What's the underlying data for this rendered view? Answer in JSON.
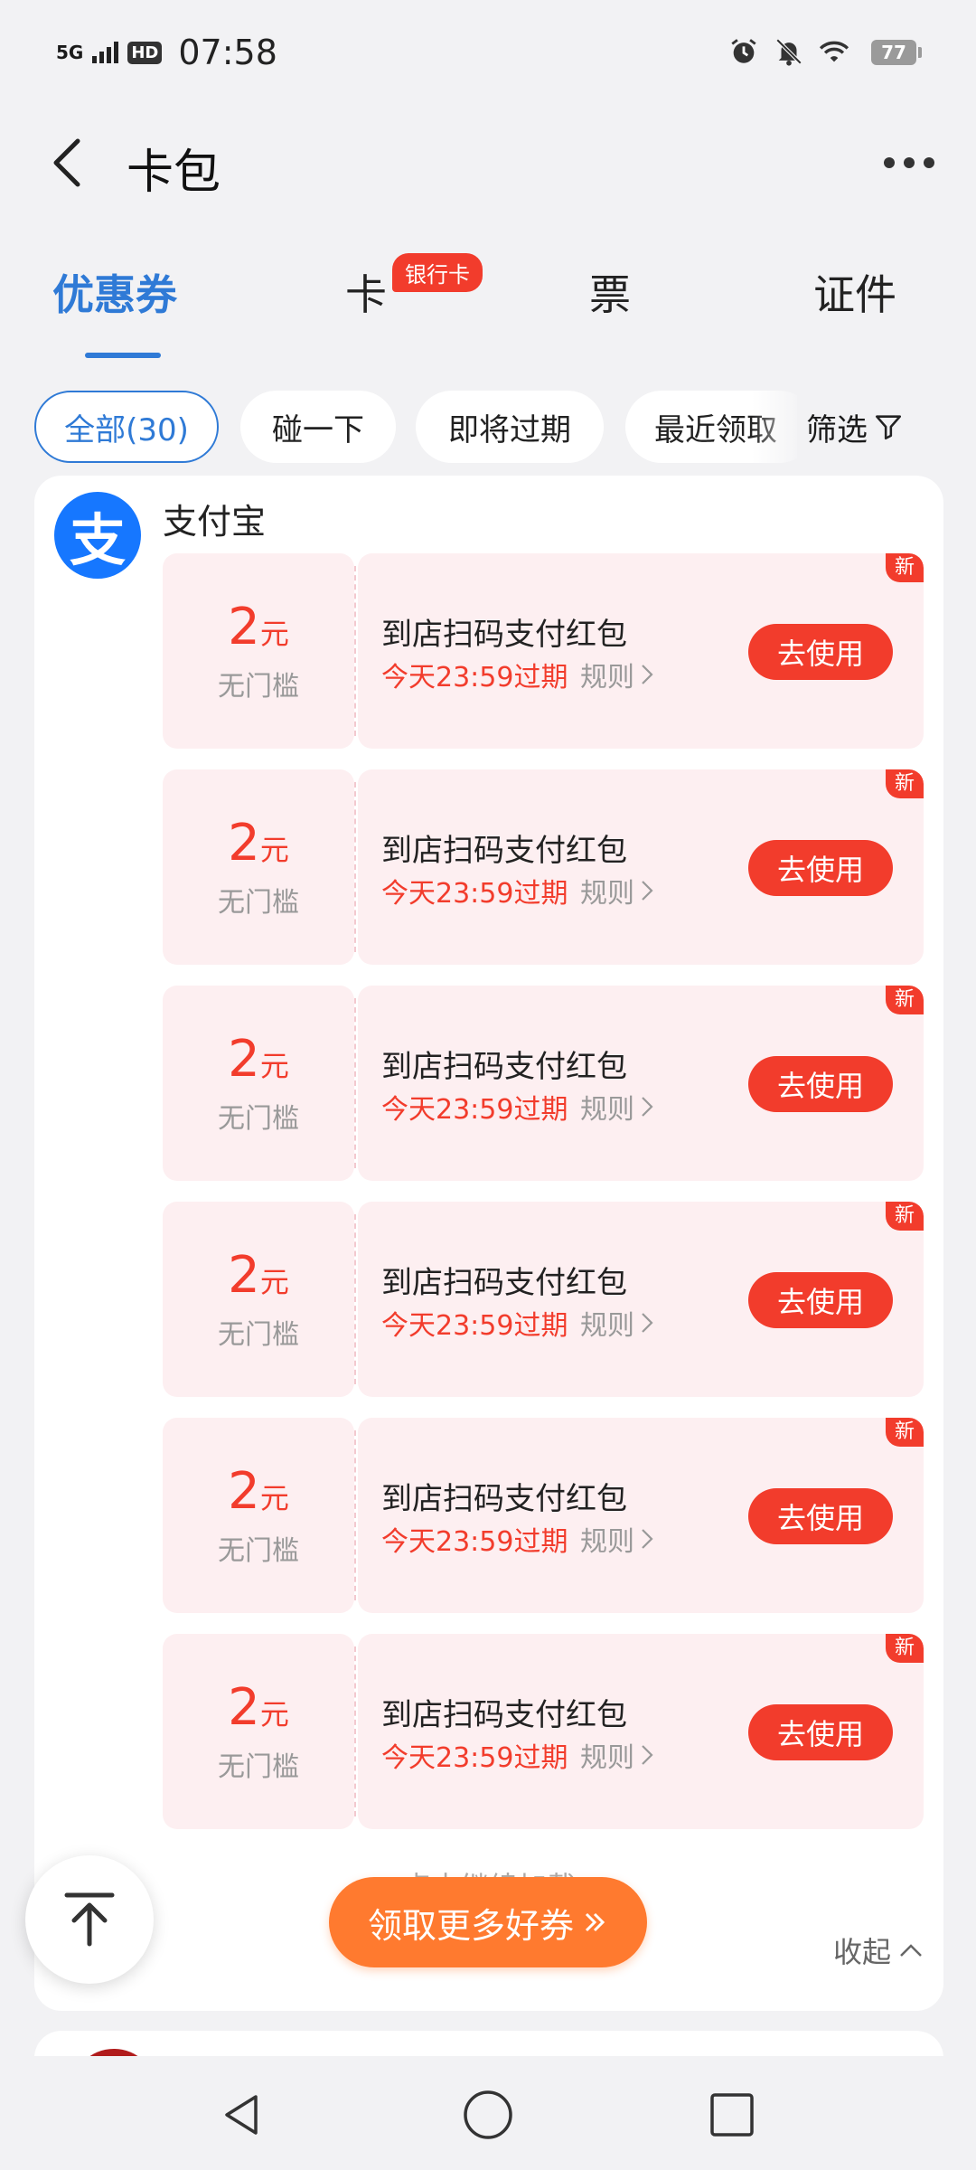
{
  "status_bar": {
    "network": "5G",
    "hd": "HD",
    "time": "07:58",
    "battery": "77"
  },
  "header": {
    "title": "卡包"
  },
  "tabs": [
    {
      "label": "优惠券",
      "active": true
    },
    {
      "label": "卡",
      "active": false,
      "badge": "银行卡"
    },
    {
      "label": "票",
      "active": false
    },
    {
      "label": "证件",
      "active": false
    }
  ],
  "filters": {
    "chips": [
      "全部(30)",
      "碰一下",
      "即将过期",
      "最近领取"
    ],
    "filter_label": "筛选"
  },
  "issuer": {
    "logo_glyph": "支",
    "name": "支付宝"
  },
  "coupons": [
    {
      "amount": "2",
      "unit": "元",
      "condition": "无门槛",
      "name": "到店扫码支付红包",
      "expiry": "今天23:59过期",
      "rule": "规则",
      "button": "去使用",
      "tag": "新"
    },
    {
      "amount": "2",
      "unit": "元",
      "condition": "无门槛",
      "name": "到店扫码支付红包",
      "expiry": "今天23:59过期",
      "rule": "规则",
      "button": "去使用",
      "tag": "新"
    },
    {
      "amount": "2",
      "unit": "元",
      "condition": "无门槛",
      "name": "到店扫码支付红包",
      "expiry": "今天23:59过期",
      "rule": "规则",
      "button": "去使用",
      "tag": "新"
    },
    {
      "amount": "2",
      "unit": "元",
      "condition": "无门槛",
      "name": "到店扫码支付红包",
      "expiry": "今天23:59过期",
      "rule": "规则",
      "button": "去使用",
      "tag": "新"
    },
    {
      "amount": "2",
      "unit": "元",
      "condition": "无门槛",
      "name": "到店扫码支付红包",
      "expiry": "今天23:59过期",
      "rule": "规则",
      "button": "去使用",
      "tag": "新"
    },
    {
      "amount": "2",
      "unit": "元",
      "condition": "无门槛",
      "name": "到店扫码支付红包",
      "expiry": "今天23:59过期",
      "rule": "规则",
      "button": "去使用",
      "tag": "新"
    }
  ],
  "footer": {
    "load_more": "点击继续加载",
    "collapse": "收起",
    "get_more": "领取更多好券"
  },
  "colors": {
    "accent_blue": "#2f7ad6",
    "coupon_red": "#f23c2c",
    "coupon_bg": "#fdeff1",
    "orange": "#ff7a2f"
  }
}
